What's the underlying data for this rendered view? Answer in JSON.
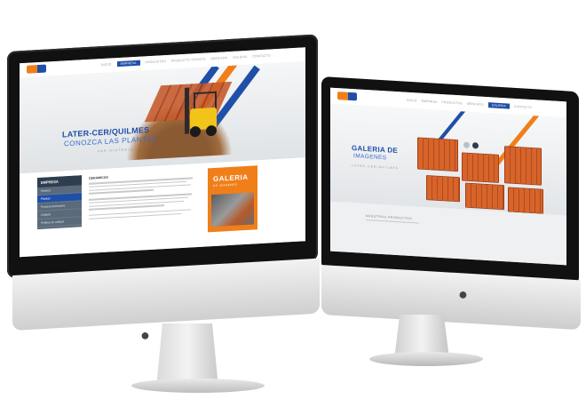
{
  "left_site": {
    "nav": [
      "INICIO",
      "EMPRESA",
      "PRODUCTOS",
      "PRODUCTO TECNICO",
      "MERCADO",
      "GALERIA",
      "CONTACTO"
    ],
    "nav_active_index": 1,
    "hero": {
      "title": "LATER-CER/QUILMES",
      "subtitle": "CONOZCA LAS PLANTAS",
      "tagline": "VER HISTORIA"
    },
    "sidebar": {
      "title": "EMPRESA",
      "items": [
        "Historia",
        "Plantas",
        "Proceso productivo",
        "Calidad",
        "Política de calidad"
      ],
      "active_index": 1
    },
    "text_heading": "CERAMICAS",
    "gallery": {
      "title": "GALERIA",
      "subtitle": "DE IMAGENES"
    }
  },
  "right_site": {
    "nav": [
      "INICIO",
      "EMPRESA",
      "PRODUCTOS",
      "MERCADO",
      "GALERIA",
      "CONTACTO"
    ],
    "nav_active_index": 4,
    "title_line1": "GALERIA DE",
    "title_line2": "IMAGENES",
    "tagline": "LATER-CER/QUILMES",
    "products_label": "NUESTROS PRODUCTOS"
  },
  "colors": {
    "brand_blue": "#1f4fa8",
    "brand_orange": "#f07f1a"
  },
  "icons": [
    "apple-logo-icon",
    "apple-logo-icon"
  ]
}
